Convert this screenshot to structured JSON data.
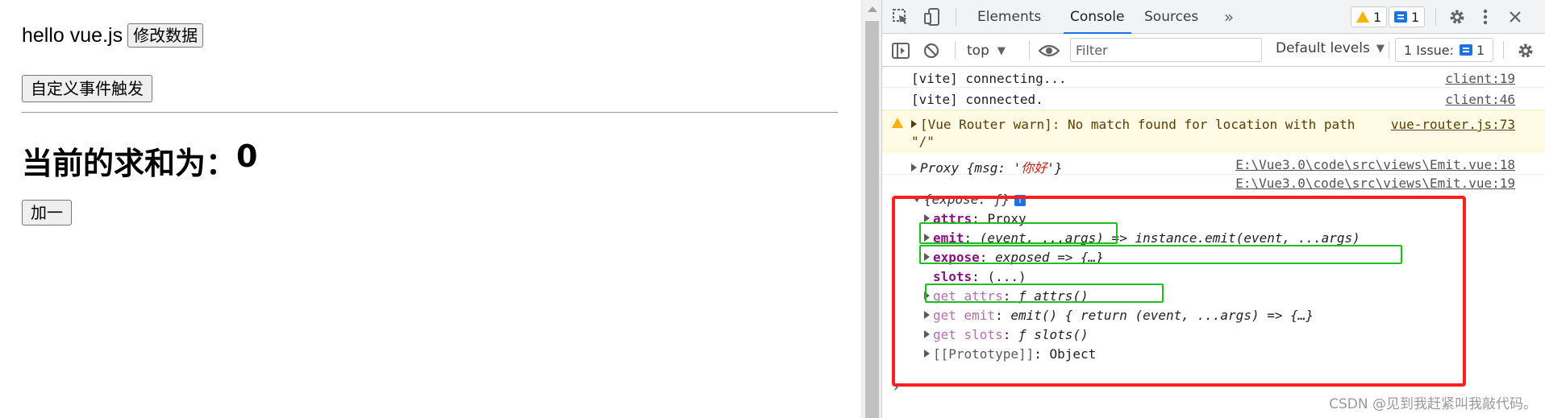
{
  "app": {
    "hello_text": "hello vue.js",
    "modify_button": "修改数据",
    "emit_button": "自定义事件触发",
    "sum_label": "当前的求和为：",
    "sum_value": "0",
    "add_button": "加一"
  },
  "devtools": {
    "tabs": [
      "Elements",
      "Console",
      "Sources"
    ],
    "active_tab": "Console",
    "warning_count": "1",
    "message_count": "1",
    "context": "top",
    "filter_placeholder": "Filter",
    "levels": "Default levels",
    "issues_label": "1 Issue:",
    "issues_count": "1"
  },
  "console": {
    "lines": [
      {
        "text": "[vite] connecting...",
        "source": "client:19"
      },
      {
        "text": "[vite] connected.",
        "source": "client:46"
      },
      {
        "text": "[Vue Router warn]: No match found for location with path",
        "text2": "\"/\"",
        "source": "vue-router.js:73"
      },
      {
        "text": "Proxy {msg: '",
        "str": "你好",
        "tail": "'}",
        "source": "E:\\Vue3.0\\code\\src\\views\\Emit.vue:18"
      },
      {
        "source": "E:\\Vue3.0\\code\\src\\views\\Emit.vue:19"
      }
    ],
    "object_header": "{expose: ƒ}",
    "props": [
      {
        "key": "attrs",
        "value": "Proxy"
      },
      {
        "key": "emit",
        "value": "(event, ...args) => instance.emit(event, ...args)"
      },
      {
        "key": "expose",
        "value": "exposed => {…}"
      },
      {
        "key": "slots",
        "value": "(...)"
      },
      {
        "key": "get attrs",
        "value": "ƒ attrs()"
      },
      {
        "key": "get emit",
        "value": "emit() { return (event, ...args) => {…}"
      },
      {
        "key": "get slots",
        "value": "ƒ slots()"
      },
      {
        "key": "[[Prototype]]",
        "value": "Object"
      }
    ]
  },
  "watermark": "CSDN @见到我赶紧叫我敲代码。"
}
